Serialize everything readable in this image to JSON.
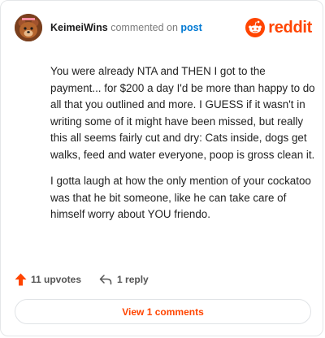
{
  "header": {
    "username": "KeimeiWins",
    "action_text": "commented on",
    "post_link": "post",
    "brand_name": "reddit"
  },
  "comment": {
    "paragraphs": [
      "You were already NTA and THEN I got to the payment... for $200 a day I'd be more than happy to do all that you outlined and more. I GUESS if it wasn't in writing some of it might have been missed, but really this all seems fairly cut and dry: Cats inside, dogs get walks, feed and water everyone, poop is gross clean it.",
      "I gotta laugh at how the only mention of your cockatoo was that he bit someone, like he can take care of himself worry about YOU friendo."
    ]
  },
  "actions": {
    "upvotes_label": "11 upvotes",
    "reply_label": "1 reply"
  },
  "footer": {
    "view_comments_label": "View 1 comments"
  },
  "colors": {
    "brand": "#ff4500",
    "link": "#0079d3",
    "avatar_bg": "#6b3b1f"
  },
  "icons": {
    "avatar": "bear-avatar",
    "brand": "reddit-snoo-icon",
    "upvote": "upvote-arrow-icon",
    "reply": "reply-arrow-icon"
  }
}
